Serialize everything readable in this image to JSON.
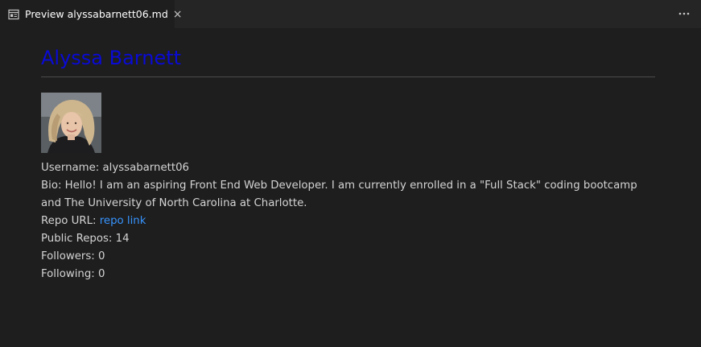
{
  "tab": {
    "label": "Preview alyssabarnett06.md",
    "icon": "preview-icon",
    "close_glyph": "×"
  },
  "toolbar": {
    "more_icon": "more-actions-icon"
  },
  "document": {
    "title": "Alyssa Barnett",
    "title_color": "#0a0ad6",
    "link_color": "#3794ff",
    "username_label": "Username:",
    "username": "alyssabarnett06",
    "bio_label": "Bio:",
    "bio": "Hello! I am an aspiring Front End Web Developer. I am currently enrolled in a \"Full Stack\" coding bootcamp and The University of North Carolina at Charlotte.",
    "repo_label": "Repo URL:",
    "repo_link_text": "repo link",
    "public_repos_label": "Public Repos:",
    "public_repos": "14",
    "followers_label": "Followers:",
    "followers": "0",
    "following_label": "Following:",
    "following": "0"
  }
}
